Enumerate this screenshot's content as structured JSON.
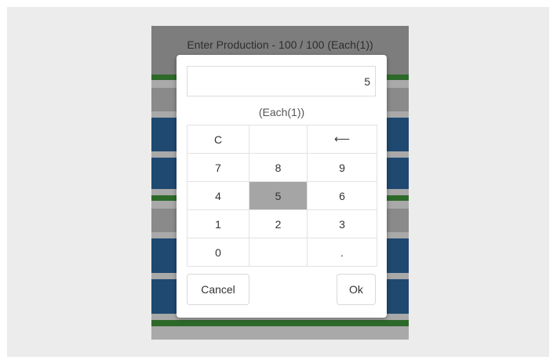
{
  "screen": {
    "title": "Enter Production - 100 / 100 (Each(1))"
  },
  "dialog": {
    "value": "5",
    "unit_label": "(Each(1))",
    "keys": [
      "C",
      "",
      "⟵",
      "7",
      "8",
      "9",
      "4",
      "5",
      "6",
      "1",
      "2",
      "3",
      "0",
      "",
      "."
    ],
    "highlighted_key": "5",
    "cancel_label": "Cancel",
    "ok_label": "Ok"
  },
  "colors": {
    "band_green": "#2d6a2a",
    "band_blue": "#1f4970",
    "highlight": "#a5a5a5"
  }
}
